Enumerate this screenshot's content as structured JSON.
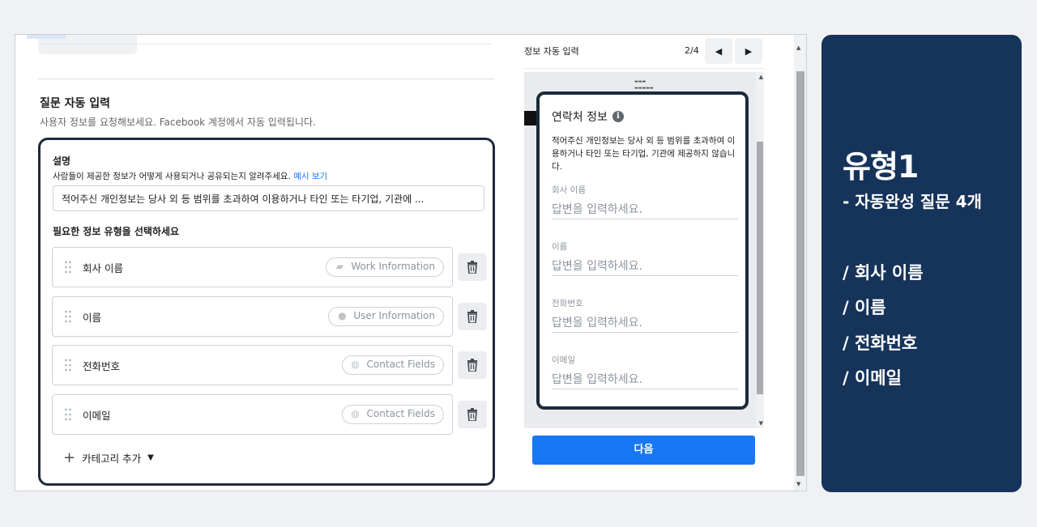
{
  "form": {
    "section_title": "질문 자동 입력",
    "section_subtitle": "사용자 정보를 요청해보세요. Facebook 계정에서 자동 입력됩니다.",
    "description_label": "설명",
    "description_help": "사람들이 제공한 정보가 어떻게 사용되거나 공유되는지 알려주세요.",
    "description_help_link": "예시 보기",
    "description_value": "적어주신 개인정보는 당사 외 등 범위를 초과하여 이용하거나 타인 또는 타기업, 기관에 ...",
    "type_label": "필요한 정보 유형을 선택하세요",
    "questions": [
      {
        "label": "회사 이름",
        "category": "Work Information",
        "icon": "briefcase-icon"
      },
      {
        "label": "이름",
        "category": "User Information",
        "icon": "user-icon"
      },
      {
        "label": "전화번호",
        "category": "Contact Fields",
        "icon": "chat-bubbles-icon"
      },
      {
        "label": "이메일",
        "category": "Contact Fields",
        "icon": "chat-bubbles-icon"
      }
    ],
    "add_category_label": "카테고리 추가"
  },
  "preview": {
    "title": "정보 자동 입력",
    "page_indicator": "2/4",
    "card_title": "연락처 정보",
    "card_description": "적어주신 개인정보는 당사 외 등 범위를 초과하여 이용하거나 타인 또는 타기업, 기관에 제공하지 않습니다.",
    "fields": [
      {
        "label": "회사 이름",
        "placeholder": "답변을 입력하세요."
      },
      {
        "label": "이름",
        "placeholder": "답변을 입력하세요."
      },
      {
        "label": "전화번호",
        "placeholder": "답변을 입력하세요."
      },
      {
        "label": "이메일",
        "placeholder": "답변을 입력하세요."
      }
    ],
    "next_button": "다음"
  },
  "side": {
    "title": "유형1",
    "subtitle": "- 자동완성 질문 4개",
    "items": [
      "/ 회사 이름",
      "/ 이름",
      "/ 전화번호",
      "/ 이메일"
    ]
  },
  "colors": {
    "accent": "#1877f2",
    "side_panel": "#16335a",
    "highlight_border": "#1c2a3a"
  }
}
